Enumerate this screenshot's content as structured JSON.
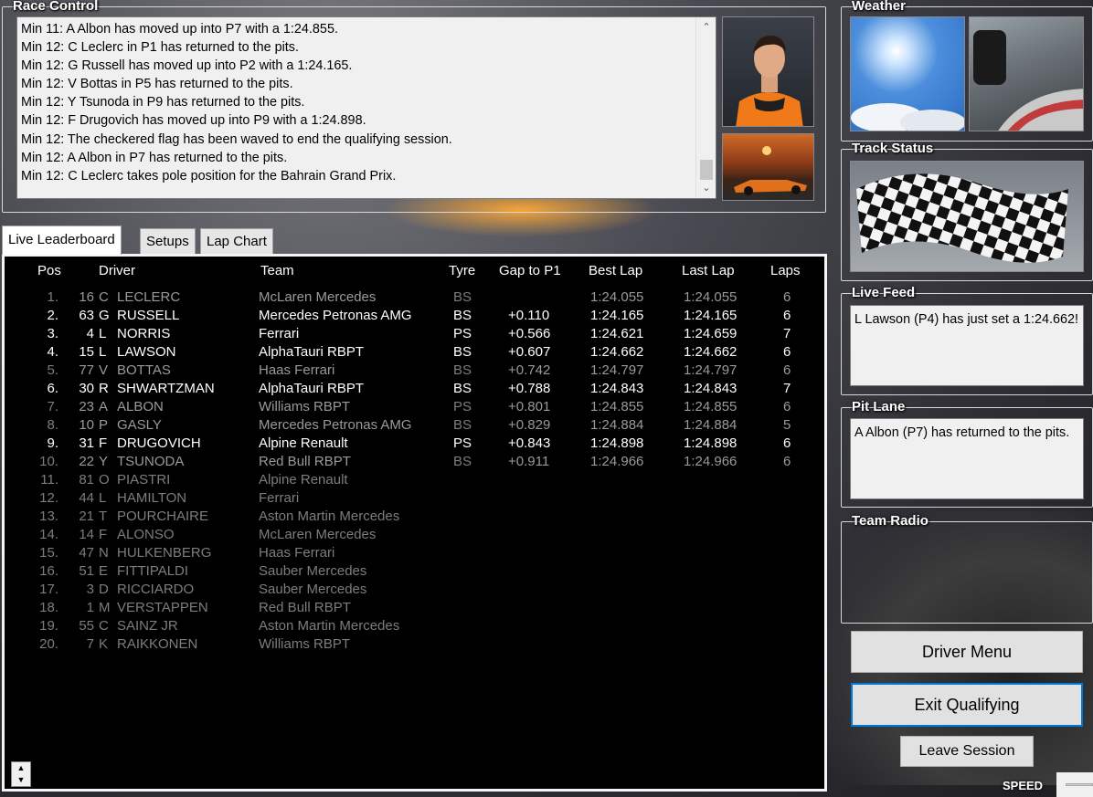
{
  "race_control": {
    "title": "Race Control",
    "messages": [
      "Min 11: A Albon has moved up into P7 with a 1:24.855.",
      "Min 12: C Leclerc in P1 has returned to the pits.",
      "Min 12: G Russell has moved up into P2 with a 1:24.165.",
      "Min 12: V Bottas in P5 has returned to the pits.",
      "Min 12: Y Tsunoda in P9 has returned to the pits.",
      "Min 12: F Drugovich has moved up into P9 with a 1:24.898.",
      "Min 12: The checkered flag has been waved to end the qualifying session.",
      "Min 12: A Albon in P7 has returned to the pits.",
      "Min 12: C Leclerc takes pole position for the Bahrain Grand Prix."
    ]
  },
  "tabs": [
    "Live Leaderboard",
    "Setups",
    "Lap Chart"
  ],
  "leaderboard": {
    "headers": {
      "pos": "Pos",
      "driver": "Driver",
      "team": "Team",
      "tyre": "Tyre",
      "gap": "Gap to P1",
      "best": "Best Lap",
      "last": "Last Lap",
      "laps": "Laps"
    },
    "rows": [
      {
        "pos": "1.",
        "num": "16",
        "init": "C",
        "name": "LECLERC",
        "team": "McLaren Mercedes",
        "tyre": "BS",
        "gap": "",
        "best": "1:24.055",
        "last": "1:24.055",
        "laps": "6",
        "style": "dim",
        "tyre_dim": true
      },
      {
        "pos": "2.",
        "num": "63",
        "init": "G",
        "name": "RUSSELL",
        "team": "Mercedes Petronas AMG",
        "tyre": "BS",
        "gap": "+0.110",
        "best": "1:24.165",
        "last": "1:24.165",
        "laps": "6",
        "style": "hi",
        "tyre_dim": false
      },
      {
        "pos": "3.",
        "num": "4",
        "init": "L",
        "name": "NORRIS",
        "team": "Ferrari",
        "tyre": "PS",
        "gap": "+0.566",
        "best": "1:24.621",
        "last": "1:24.659",
        "laps": "7",
        "style": "hi",
        "tyre_dim": false
      },
      {
        "pos": "4.",
        "num": "15",
        "init": "L",
        "name": "LAWSON",
        "team": "AlphaTauri RBPT",
        "tyre": "BS",
        "gap": "+0.607",
        "best": "1:24.662",
        "last": "1:24.662",
        "laps": "6",
        "style": "hi",
        "tyre_dim": false
      },
      {
        "pos": "5.",
        "num": "77",
        "init": "V",
        "name": "BOTTAS",
        "team": "Haas Ferrari",
        "tyre": "BS",
        "gap": "+0.742",
        "best": "1:24.797",
        "last": "1:24.797",
        "laps": "6",
        "style": "dim",
        "tyre_dim": true
      },
      {
        "pos": "6.",
        "num": "30",
        "init": "R",
        "name": "SHWARTZMAN",
        "team": "AlphaTauri RBPT",
        "tyre": "BS",
        "gap": "+0.788",
        "best": "1:24.843",
        "last": "1:24.843",
        "laps": "7",
        "style": "hi",
        "tyre_dim": false
      },
      {
        "pos": "7.",
        "num": "23",
        "init": "A",
        "name": "ALBON",
        "team": "Williams RBPT",
        "tyre": "PS",
        "gap": "+0.801",
        "best": "1:24.855",
        "last": "1:24.855",
        "laps": "6",
        "style": "dim",
        "tyre_dim": true
      },
      {
        "pos": "8.",
        "num": "10",
        "init": "P",
        "name": "GASLY",
        "team": "Mercedes Petronas AMG",
        "tyre": "BS",
        "gap": "+0.829",
        "best": "1:24.884",
        "last": "1:24.884",
        "laps": "5",
        "style": "dim",
        "tyre_dim": true
      },
      {
        "pos": "9.",
        "num": "31",
        "init": "F",
        "name": "DRUGOVICH",
        "team": "Alpine Renault",
        "tyre": "PS",
        "gap": "+0.843",
        "best": "1:24.898",
        "last": "1:24.898",
        "laps": "6",
        "style": "hi",
        "tyre_dim": false
      },
      {
        "pos": "10.",
        "num": "22",
        "init": "Y",
        "name": "TSUNODA",
        "team": "Red Bull RBPT",
        "tyre": "BS",
        "gap": "+0.911",
        "best": "1:24.966",
        "last": "1:24.966",
        "laps": "6",
        "style": "dim",
        "tyre_dim": true
      },
      {
        "pos": "11.",
        "num": "81",
        "init": "O",
        "name": "PIASTRI",
        "team": "Alpine Renault",
        "tyre": "",
        "gap": "",
        "best": "",
        "last": "",
        "laps": "",
        "style": "gray",
        "tyre_dim": true
      },
      {
        "pos": "12.",
        "num": "44",
        "init": "L",
        "name": "HAMILTON",
        "team": "Ferrari",
        "tyre": "",
        "gap": "",
        "best": "",
        "last": "",
        "laps": "",
        "style": "gray",
        "tyre_dim": true
      },
      {
        "pos": "13.",
        "num": "21",
        "init": "T",
        "name": "POURCHAIRE",
        "team": "Aston Martin Mercedes",
        "tyre": "",
        "gap": "",
        "best": "",
        "last": "",
        "laps": "",
        "style": "gray",
        "tyre_dim": true
      },
      {
        "pos": "14.",
        "num": "14",
        "init": "F",
        "name": "ALONSO",
        "team": "McLaren Mercedes",
        "tyre": "",
        "gap": "",
        "best": "",
        "last": "",
        "laps": "",
        "style": "gray",
        "tyre_dim": true
      },
      {
        "pos": "15.",
        "num": "47",
        "init": "N",
        "name": "HULKENBERG",
        "team": "Haas Ferrari",
        "tyre": "",
        "gap": "",
        "best": "",
        "last": "",
        "laps": "",
        "style": "gray",
        "tyre_dim": true
      },
      {
        "pos": "16.",
        "num": "51",
        "init": "E",
        "name": "FITTIPALDI",
        "team": "Sauber Mercedes",
        "tyre": "",
        "gap": "",
        "best": "",
        "last": "",
        "laps": "",
        "style": "gray",
        "tyre_dim": true
      },
      {
        "pos": "17.",
        "num": "3",
        "init": "D",
        "name": "RICCIARDO",
        "team": "Sauber Mercedes",
        "tyre": "",
        "gap": "",
        "best": "",
        "last": "",
        "laps": "",
        "style": "gray",
        "tyre_dim": true
      },
      {
        "pos": "18.",
        "num": "1",
        "init": "M",
        "name": "VERSTAPPEN",
        "team": "Red Bull RBPT",
        "tyre": "",
        "gap": "",
        "best": "",
        "last": "",
        "laps": "",
        "style": "gray",
        "tyre_dim": true
      },
      {
        "pos": "19.",
        "num": "55",
        "init": "C",
        "name": "SAINZ JR",
        "team": "Aston Martin Mercedes",
        "tyre": "",
        "gap": "",
        "best": "",
        "last": "",
        "laps": "",
        "style": "gray",
        "tyre_dim": true
      },
      {
        "pos": "20.",
        "num": "7",
        "init": "K",
        "name": "RAIKKONEN",
        "team": "Williams RBPT",
        "tyre": "",
        "gap": "",
        "best": "",
        "last": "",
        "laps": "",
        "style": "gray",
        "tyre_dim": true
      }
    ]
  },
  "weather": {
    "title": "Weather"
  },
  "track_status": {
    "title": "Track Status"
  },
  "live_feed": {
    "title": "Live Feed",
    "text": "L Lawson (P4) has just set a 1:24.662!"
  },
  "pit_lane": {
    "title": "Pit Lane",
    "text": "A Albon (P7) has returned to the pits."
  },
  "team_radio": {
    "title": "Team Radio"
  },
  "buttons": {
    "driver_menu": "Driver Menu",
    "exit_qualifying": "Exit Qualifying",
    "leave_session": "Leave Session"
  },
  "speed": {
    "label": "SPEED"
  },
  "colors": {
    "board_bg": "#000000",
    "panel_bg": "#f0f0f0",
    "focus_border": "#0078d7"
  }
}
